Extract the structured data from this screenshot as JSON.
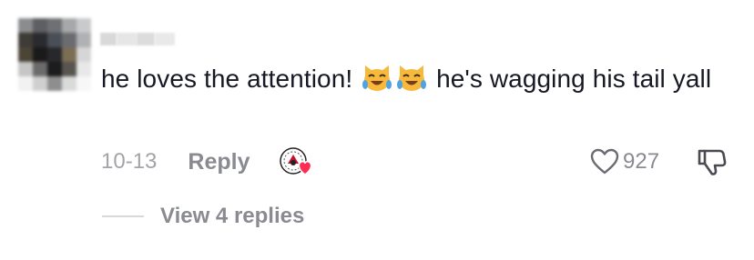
{
  "comment": {
    "text_part1": "he loves the attention!",
    "emoji_1": "laughing-cat-emoji",
    "emoji_2": "laughing-cat-emoji",
    "text_part2": "he's wagging his tail yall",
    "date": "10-13",
    "reply_label": "Reply",
    "like_count": "927",
    "view_replies_label": "View 4 replies"
  },
  "icons": {
    "like": "heart-outline-icon",
    "dislike": "thumbs-down-icon",
    "creator_liked": "creator-avatar-heart-icon"
  },
  "colors": {
    "text": "#161823",
    "secondary": "#8a8b91",
    "date": "#a3a4a9",
    "heart_accent": "#fe2c55"
  }
}
